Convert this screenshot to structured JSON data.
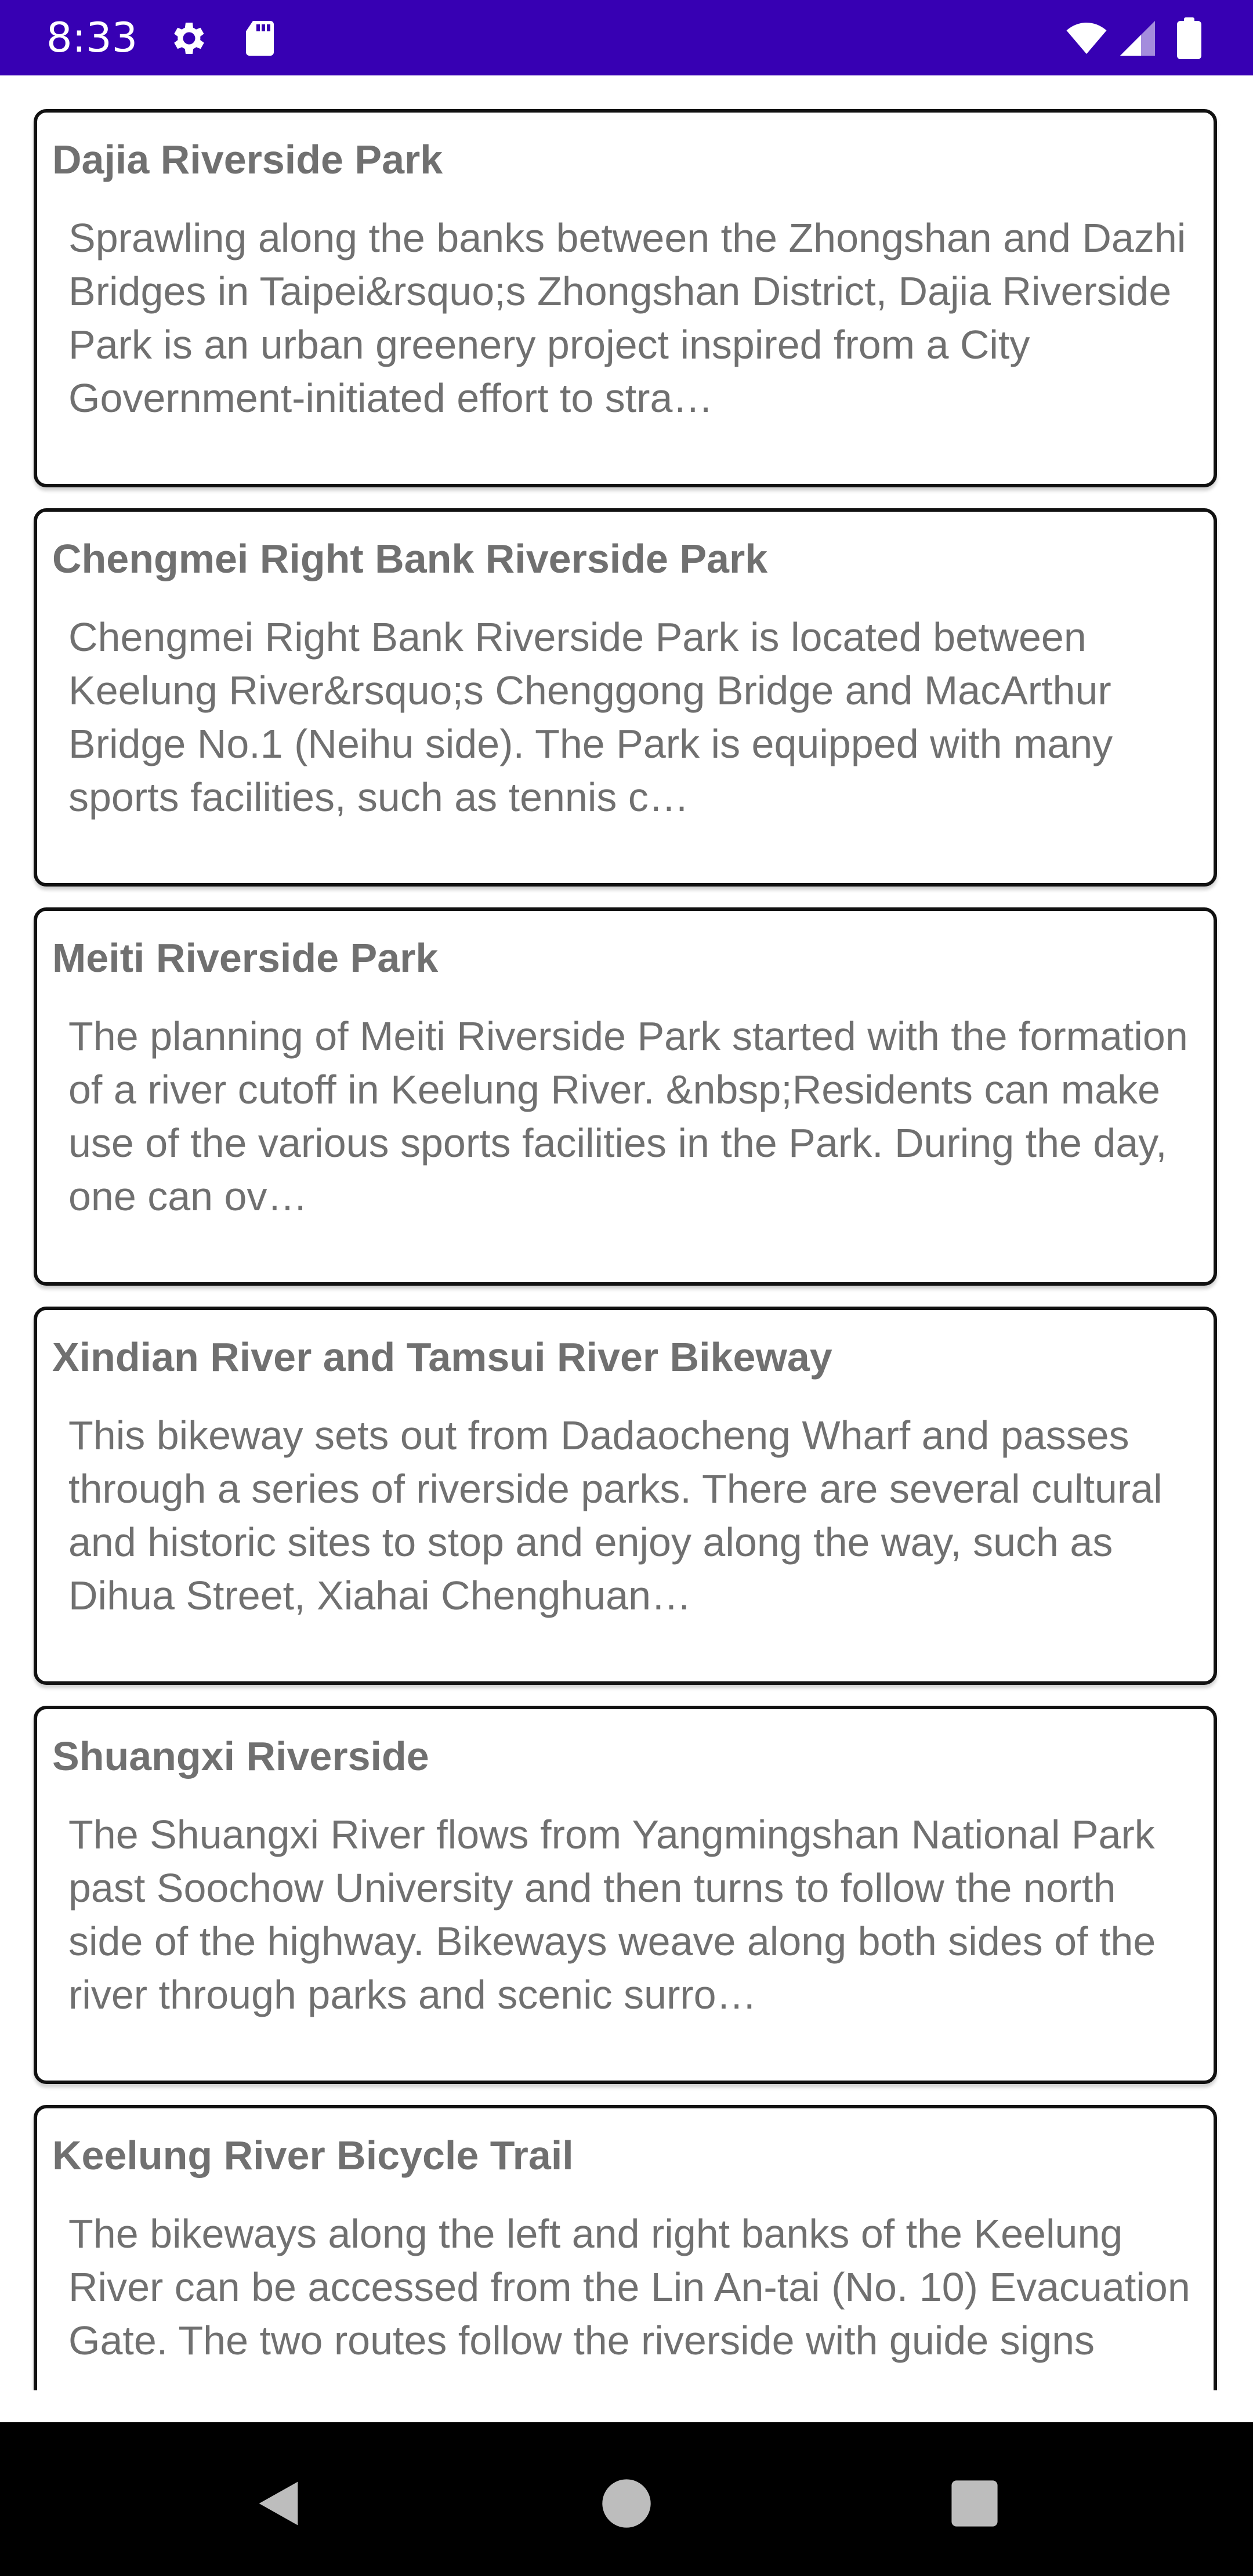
{
  "status_bar": {
    "time": "8:33",
    "background": "#3700b3",
    "icons": [
      "settings-gear-icon",
      "sd-card-icon",
      "wifi-icon",
      "signal-icon",
      "battery-icon"
    ]
  },
  "places": [
    {
      "title": "Dajia Riverside Park",
      "description": "Sprawling along the banks between the Zhongshan and Dazhi Bridges in Taipei&rsquo;s Zhongshan District, Dajia Riverside Park is an urban greenery project inspired from a City Government-initiated effort to stra…"
    },
    {
      "title": "Chengmei Right Bank Riverside Park",
      "description": "Chengmei Right Bank Riverside Park is located between Keelung River&rsquo;s Chenggong Bridge and MacArthur Bridge No.1 (Neihu side). The Park is equipped with many sports facilities, such as tennis c…"
    },
    {
      "title": "Meiti Riverside Park",
      "description": "The planning of Meiti Riverside Park started with the formation of a river cutoff in Keelung River. &nbsp;Residents can make use of the various sports facilities in the Park. During the day, one can ov…"
    },
    {
      "title": "Xindian River and Tamsui River Bikeway",
      "description": "This bikeway sets out from Dadaocheng Wharf and passes through a series of riverside parks. There are several cultural and historic sites to stop and enjoy along the way, such as Dihua Street, Xiahai Chenghuan…"
    },
    {
      "title": "Shuangxi Riverside",
      "description": "The Shuangxi River flows from Yangmingshan National Park past Soochow University and then turns to follow the north side of the highway. Bikeways weave along both sides of the river through parks and scenic surro…"
    },
    {
      "title": "Keelung River Bicycle Trail",
      "description": "The bikeways along the left and right banks of the Keelung River can be accessed from the Lin An-tai (No. 10) Evacuation Gate. The two routes follow the riverside with guide signs along the way introducing the history"
    }
  ],
  "nav_bar": {
    "buttons": [
      "back-icon",
      "home-icon",
      "recents-icon"
    ]
  }
}
